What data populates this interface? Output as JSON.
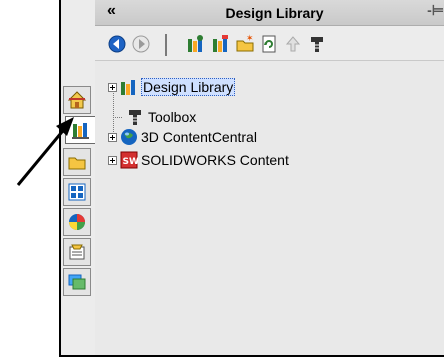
{
  "panel": {
    "collapse_glyph": "«",
    "title": "Design Library",
    "pin_glyph": "-⊨"
  },
  "toolbar": {
    "buttons": [
      {
        "icon": "back-icon"
      },
      {
        "icon": "forward-icon"
      },
      {
        "icon": "add-to-library-icon"
      },
      {
        "icon": "add-file-location-icon"
      },
      {
        "icon": "create-new-folder-icon"
      },
      {
        "icon": "refresh-icon"
      },
      {
        "icon": "up-one-level-icon"
      },
      {
        "icon": "toolbox-icon"
      }
    ]
  },
  "tree": {
    "items": [
      {
        "label": "Design Library",
        "icon": "design-library-icon",
        "expandable": true,
        "selected": true
      },
      {
        "label": "Toolbox",
        "icon": "toolbox-icon",
        "expandable": false
      },
      {
        "label": "3D ContentCentral",
        "icon": "globe-icon",
        "expandable": true
      },
      {
        "label": "SOLIDWORKS Content",
        "icon": "solidworks-icon",
        "expandable": true
      }
    ]
  },
  "tabs": [
    {
      "icon": "home-icon"
    },
    {
      "icon": "design-library-icon",
      "active": true
    },
    {
      "icon": "file-explorer-icon"
    },
    {
      "icon": "view-palette-icon"
    },
    {
      "icon": "appearances-icon"
    },
    {
      "icon": "custom-properties-icon"
    },
    {
      "icon": "solidworks-forum-icon"
    }
  ],
  "colors": {
    "selection": "#cfe0ff",
    "panel_bg": "#e9e9e9"
  }
}
